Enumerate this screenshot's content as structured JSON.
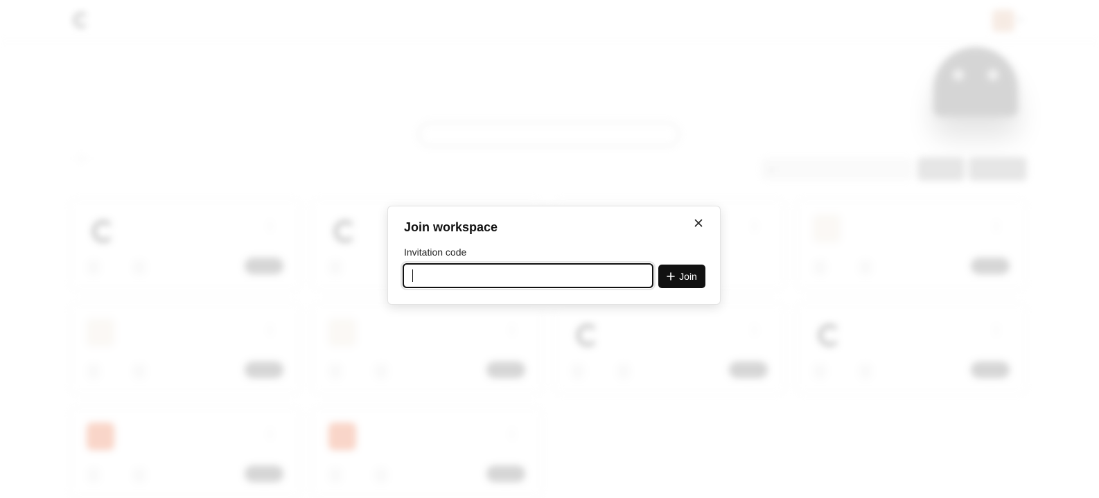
{
  "modal": {
    "title": "Join workspace",
    "field_label": "Invitation code",
    "input_value": "",
    "input_placeholder": "",
    "submit_label": "Join",
    "close_icon": "close-icon",
    "submit_icon": "plus-icon"
  },
  "colors": {
    "primary": "#111111",
    "modal_bg": "#ffffff",
    "backdrop": "#ffffff"
  }
}
